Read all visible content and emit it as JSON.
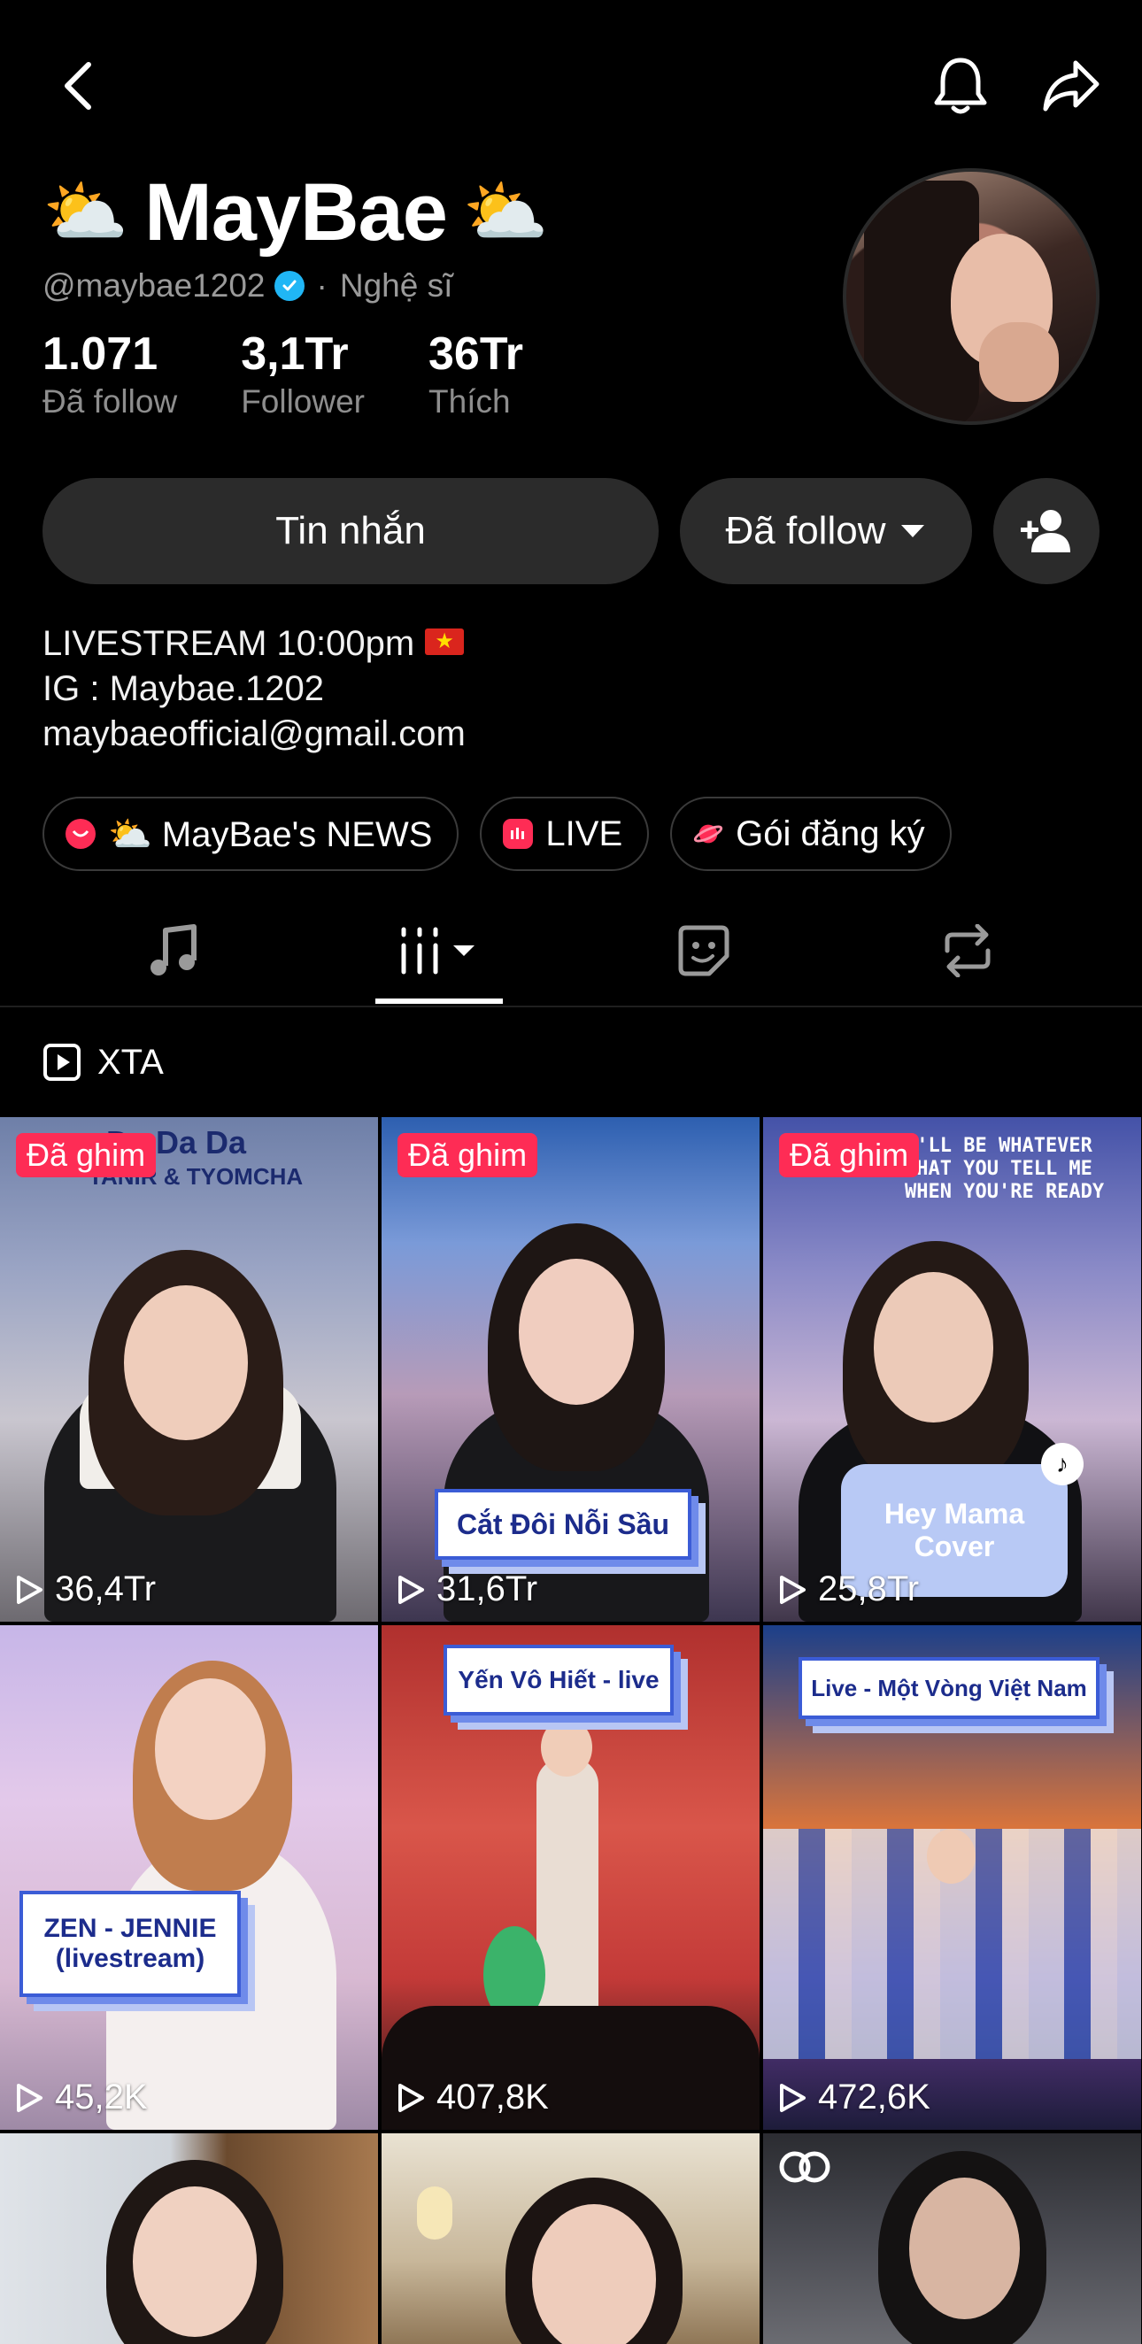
{
  "profile": {
    "name_emoji_left": "⛅",
    "name": "MayBae",
    "name_emoji_right": "⛅",
    "handle": "@maybae1202",
    "separator": "·",
    "category": "Nghệ sĩ"
  },
  "stats": [
    {
      "value": "1.071",
      "label": "Đã follow"
    },
    {
      "value": "3,1Tr",
      "label": "Follower"
    },
    {
      "value": "36Tr",
      "label": "Thích"
    }
  ],
  "actions": {
    "message_label": "Tin nhắn",
    "following_label": "Đã follow"
  },
  "bio": {
    "line1": "LIVESTREAM 10:00pm",
    "flag": "★",
    "line2": "IG : Maybae.1202",
    "line3": "maybaeofficial@gmail.com"
  },
  "chips": [
    {
      "label": "⛅ MayBae's NEWS",
      "icon": "news-icon",
      "color": "#fe2c55"
    },
    {
      "label": "LIVE",
      "icon": "live-icon",
      "color": "#fe2c55"
    },
    {
      "label": "Gói đăng ký",
      "icon": "subscription-icon",
      "color": "#fe2c55"
    }
  ],
  "tabs": [
    {
      "icon": "music-icon",
      "selected": false
    },
    {
      "icon": "videos-grid-icon",
      "selected": true
    },
    {
      "icon": "sticker-icon",
      "selected": false
    },
    {
      "icon": "repost-icon",
      "selected": false
    }
  ],
  "filter": {
    "label": "XTA"
  },
  "videos": [
    {
      "pinned": "Đã ghim",
      "views": "36,4Tr",
      "overlay_title": "Da Da Da",
      "overlay_sub": "TANIR & TYOMCHA"
    },
    {
      "pinned": "Đã ghim",
      "views": "31,6Tr",
      "caption": "Cắt Đôi Nỗi Sầu"
    },
    {
      "pinned": "Đã ghim",
      "views": "25,8Tr",
      "overlay_text": "I'LL BE WHATEVER\nTHAT YOU TELL ME\nWHEN YOU'RE READY",
      "caption": "Hey Mama\nCover"
    },
    {
      "views": "45,2K",
      "caption": "ZEN - JENNIE\n(livestream)"
    },
    {
      "views": "407,8K",
      "caption": "Yến Vô Hiết - live"
    },
    {
      "views": "472,6K",
      "caption": "Live - Một Vòng Việt Nam"
    },
    {},
    {},
    {
      "badge": "co-icon"
    }
  ],
  "colors": {
    "background": "#000000",
    "accent_red": "#fe2c55",
    "verified_blue": "#20b6f5",
    "button_gray": "#2b2b2b"
  }
}
